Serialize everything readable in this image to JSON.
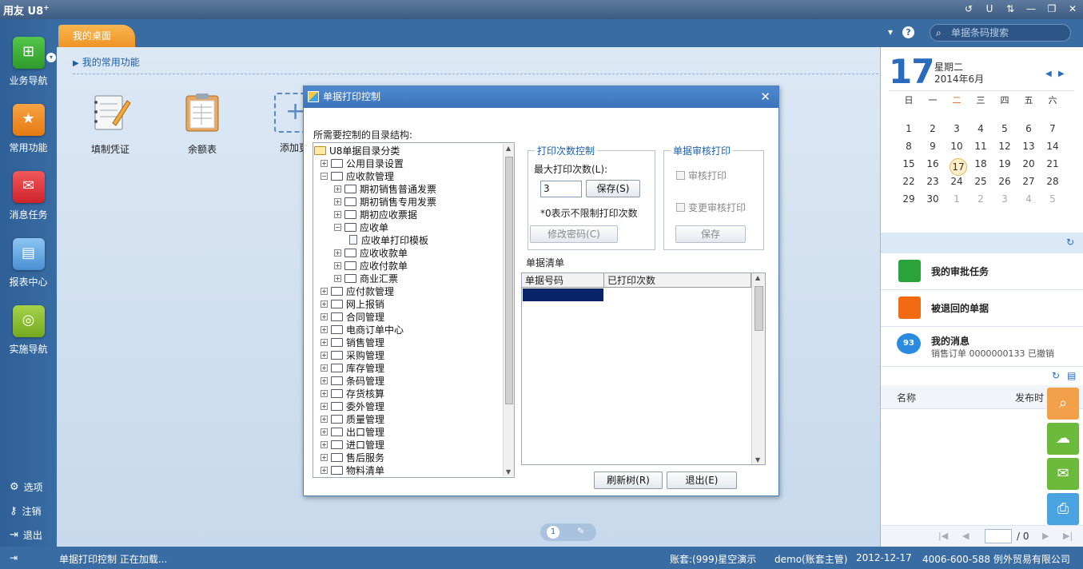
{
  "app": {
    "logo": "用友 U8",
    "logo_sup": "+"
  },
  "window_buttons": [
    "↺",
    "U",
    "⇅",
    "—",
    "❐",
    "✕"
  ],
  "left_nav": {
    "items": [
      {
        "label": "业务导航",
        "icon": "business-nav-icon",
        "color": "#3cae35"
      },
      {
        "label": "常用功能",
        "icon": "common-function-star-icon",
        "color": "#f08a24"
      },
      {
        "label": "消息任务",
        "icon": "message-task-icon",
        "color": "#e0353a"
      },
      {
        "label": "报表中心",
        "icon": "report-center-icon",
        "color": "#5aa2e0"
      },
      {
        "label": "实施导航",
        "icon": "implementation-nav-icon",
        "color": "#8cbf2e"
      }
    ],
    "bottom": [
      {
        "label": "选项",
        "icon": "gear-icon"
      },
      {
        "label": "注销",
        "icon": "key-icon"
      },
      {
        "label": "退出",
        "icon": "exit-icon"
      }
    ]
  },
  "tabs": {
    "desktop": "我的桌面"
  },
  "search": {
    "placeholder": "单据条码搜索"
  },
  "desktop": {
    "section_title": "我的常用功能",
    "shortcuts": [
      {
        "label": "填制凭证",
        "icon": "voucher-notebook-icon"
      },
      {
        "label": "余额表",
        "icon": "balance-sheet-clipboard-icon"
      },
      {
        "label": "添加更",
        "icon": "add-icon"
      }
    ],
    "page_indicator": "1"
  },
  "calendar": {
    "day": "17",
    "weekday": "星期二",
    "month": "2014年6月",
    "weekdays": [
      "日",
      "一",
      "二",
      "三",
      "四",
      "五",
      "六"
    ],
    "weeks": [
      [
        "1",
        "2",
        "3",
        "4",
        "5",
        "6",
        "7"
      ],
      [
        "8",
        "9",
        "10",
        "11",
        "12",
        "13",
        "14"
      ],
      [
        "15",
        "16",
        "17",
        "18",
        "19",
        "20",
        "21"
      ],
      [
        "22",
        "23",
        "24",
        "25",
        "26",
        "27",
        "28"
      ],
      [
        "29",
        "30",
        "1",
        "2",
        "3",
        "4",
        "5"
      ]
    ],
    "today": "17"
  },
  "tasks": {
    "approve": "我的审批任务",
    "returned": "被退回的单据",
    "messages": "我的消息",
    "message_sub": "销售订单 0000000133 已撤销",
    "message_count": "93"
  },
  "news": {
    "col_name": "名称",
    "col_time": "发布时",
    "page_total": "/ 0"
  },
  "status_bar": {
    "task": "单据打印控制 正在加载...",
    "account": "账套:(999)星空演示",
    "user": "demo(账套主管)",
    "date": "2012-12-17",
    "company": "4006-600-588 例外贸易有限公司"
  },
  "dialog": {
    "title": "单据打印控制",
    "dir_label": "所需要控制的目录结构:",
    "tree": [
      {
        "label": "U8单据目录分类",
        "level": 0,
        "type": "root"
      },
      {
        "label": "公用目录设置",
        "level": 1,
        "type": "plus"
      },
      {
        "label": "应收款管理",
        "level": 1,
        "type": "minus"
      },
      {
        "label": "期初销售普通发票",
        "level": 2,
        "type": "plus"
      },
      {
        "label": "期初销售专用发票",
        "level": 2,
        "type": "plus"
      },
      {
        "label": "期初应收票据",
        "level": 2,
        "type": "plus"
      },
      {
        "label": "应收单",
        "level": 2,
        "type": "minus"
      },
      {
        "label": "应收单打印模板",
        "level": 3,
        "type": "doc"
      },
      {
        "label": "应收收款单",
        "level": 2,
        "type": "plus"
      },
      {
        "label": "应收付款单",
        "level": 2,
        "type": "plus"
      },
      {
        "label": "商业汇票",
        "level": 2,
        "type": "plus"
      },
      {
        "label": "应付款管理",
        "level": 1,
        "type": "plus"
      },
      {
        "label": "网上报销",
        "level": 1,
        "type": "plus"
      },
      {
        "label": "合同管理",
        "level": 1,
        "type": "plus"
      },
      {
        "label": "电商订单中心",
        "level": 1,
        "type": "plus"
      },
      {
        "label": "销售管理",
        "level": 1,
        "type": "plus"
      },
      {
        "label": "采购管理",
        "level": 1,
        "type": "plus"
      },
      {
        "label": "库存管理",
        "level": 1,
        "type": "plus"
      },
      {
        "label": "条码管理",
        "level": 1,
        "type": "plus"
      },
      {
        "label": "存货核算",
        "level": 1,
        "type": "plus"
      },
      {
        "label": "委外管理",
        "level": 1,
        "type": "plus"
      },
      {
        "label": "质量管理",
        "level": 1,
        "type": "plus"
      },
      {
        "label": "出口管理",
        "level": 1,
        "type": "plus"
      },
      {
        "label": "进口管理",
        "level": 1,
        "type": "plus"
      },
      {
        "label": "售后服务",
        "level": 1,
        "type": "plus"
      },
      {
        "label": "物料清单",
        "level": 1,
        "type": "plus"
      }
    ],
    "print_count": {
      "legend": "打印次数控制",
      "max_label": "最大打印次数(L):",
      "max_value": "3",
      "save": "保存(S)",
      "note": "*0表示不限制打印次数",
      "change_password": "修改密码(C)"
    },
    "audit_print": {
      "legend": "单据审核打印",
      "audit_check": "审核打印",
      "change_audit_check": "变更审核打印",
      "save": "保存"
    },
    "list_label": "单据清单",
    "grid_headers": [
      "单据号码",
      "已打印次数"
    ],
    "refresh": "刷新树(R)",
    "exit": "退出(E)"
  }
}
